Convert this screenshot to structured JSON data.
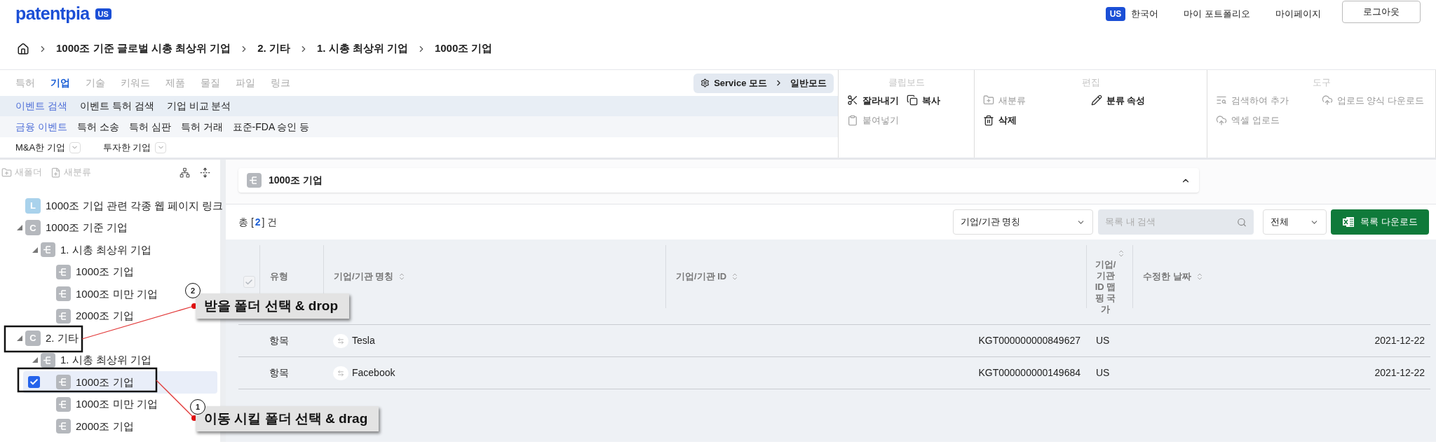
{
  "header": {
    "logo": "patentpia",
    "logo_badge": "US",
    "lang_badge": "US",
    "language": "한국어",
    "links": [
      "마이 포트폴리오",
      "마이페이지"
    ],
    "logout": "로그아웃"
  },
  "breadcrumb": [
    "1000조 기준 글로벌 시총 최상위 기업",
    "2. 기타",
    "1. 시총 최상위 기업",
    "1000조 기업"
  ],
  "ribbon": {
    "main_tabs": [
      {
        "label": "특허",
        "selected": false
      },
      {
        "label": "기업",
        "selected": true
      },
      {
        "label": "기술",
        "selected": false
      },
      {
        "label": "키워드",
        "selected": false
      },
      {
        "label": "제품",
        "selected": false
      },
      {
        "label": "물질",
        "selected": false
      },
      {
        "label": "파일",
        "selected": false
      },
      {
        "label": "링크",
        "selected": false
      }
    ],
    "mode": {
      "service": "Service 모드",
      "current": "일반모드"
    },
    "sub_tabs": [
      {
        "label": "이벤트 검색",
        "selected": true
      },
      {
        "label": "이벤트 특허 검색",
        "selected": false
      },
      {
        "label": "기업 비교 분석",
        "selected": false
      }
    ],
    "event_tabs": [
      {
        "label": "금융 이벤트",
        "selected": true
      },
      {
        "label": "특허 소송",
        "selected": false
      },
      {
        "label": "특허 심판",
        "selected": false
      },
      {
        "label": "특허 거래",
        "selected": false
      },
      {
        "label": "표준-FDA 승인 등",
        "selected": false
      }
    ],
    "filters": [
      "M&A한 기업",
      "투자한 기업"
    ],
    "groups": [
      {
        "title": "클립보드",
        "actions": [
          {
            "label": "잘라내기",
            "disabled": false
          },
          {
            "label": "복사",
            "disabled": false
          },
          {
            "label": "붙여넣기",
            "disabled": true
          }
        ]
      },
      {
        "title": "편집",
        "actions": [
          {
            "label": "새분류",
            "disabled": true
          },
          {
            "label": "분류 속성",
            "disabled": false
          },
          {
            "label": "삭제",
            "disabled": false
          }
        ]
      },
      {
        "title": "도구",
        "actions": [
          {
            "label": "검색하여 추가",
            "disabled": true
          },
          {
            "label": "업로드 양식 다운로드",
            "disabled": true
          },
          {
            "label": "엑셀 업로드",
            "disabled": true
          }
        ]
      }
    ]
  },
  "sidebar": {
    "tools": [
      {
        "label": "새폴더",
        "disabled": true
      },
      {
        "label": "새분류",
        "disabled": true
      }
    ],
    "tree": [
      {
        "label": "1000조 기업 관련 각종 웹 페이지 링크",
        "kind": "link",
        "badge": "L",
        "selected": false
      },
      {
        "label": "1000조 기준 기업",
        "kind": "class",
        "badge": "C",
        "selected": false,
        "expanded": true,
        "children": [
          {
            "label": "1. 시총 최상위 기업",
            "kind": "category",
            "selected": false,
            "expanded": true,
            "children": [
              {
                "label": "1000조 기업",
                "kind": "category",
                "selected": false
              },
              {
                "label": "1000조 미만 기업",
                "kind": "category",
                "selected": false
              },
              {
                "label": "2000조 기업",
                "kind": "category",
                "selected": false
              }
            ]
          }
        ]
      },
      {
        "label": "2. 기타",
        "kind": "class",
        "badge": "C",
        "selected": false,
        "expanded": true,
        "children": [
          {
            "label": "1. 시총 최상위 기업",
            "kind": "category",
            "selected": false,
            "expanded": true,
            "children": [
              {
                "label": "1000조 기업",
                "kind": "category",
                "selected": true
              },
              {
                "label": "1000조 미만 기업",
                "kind": "category",
                "selected": false
              },
              {
                "label": "2000조 기업",
                "kind": "category",
                "selected": false
              }
            ]
          }
        ]
      }
    ]
  },
  "main": {
    "title": "1000조 기업",
    "count": {
      "prefix": "총 [",
      "value": "2",
      "suffix": "] 건"
    },
    "field_select": "기업/기관 명칭",
    "search_placeholder": "목록 내 검색",
    "scope_select": "전체",
    "download": "목록 다운로드",
    "table": {
      "select_all": {
        "checked": true,
        "disabled": true
      },
      "columns": [
        {
          "label": "유형",
          "sortable": false
        },
        {
          "label": "기업/기관 명칭",
          "sortable": true
        },
        {
          "label": "기업/기관 ID",
          "sortable": true
        },
        {
          "label": "기업/기관 ID 맵핑 국가",
          "sortable": true
        },
        {
          "label": "수정한 날짜",
          "sortable": true
        }
      ],
      "rows": [
        {
          "type": "항목",
          "name": "Tesla",
          "id": "KGT000000000849627",
          "country": "US",
          "date": "2021-12-22"
        },
        {
          "type": "항목",
          "name": "Facebook",
          "id": "KGT000000000149684",
          "country": "US",
          "date": "2021-12-22"
        }
      ]
    }
  },
  "annotations": [
    {
      "number": "2",
      "text": "받을 폴더 선택 & drop"
    },
    {
      "number": "1",
      "text": "이동 시킬 폴더 선택 & drag"
    }
  ]
}
